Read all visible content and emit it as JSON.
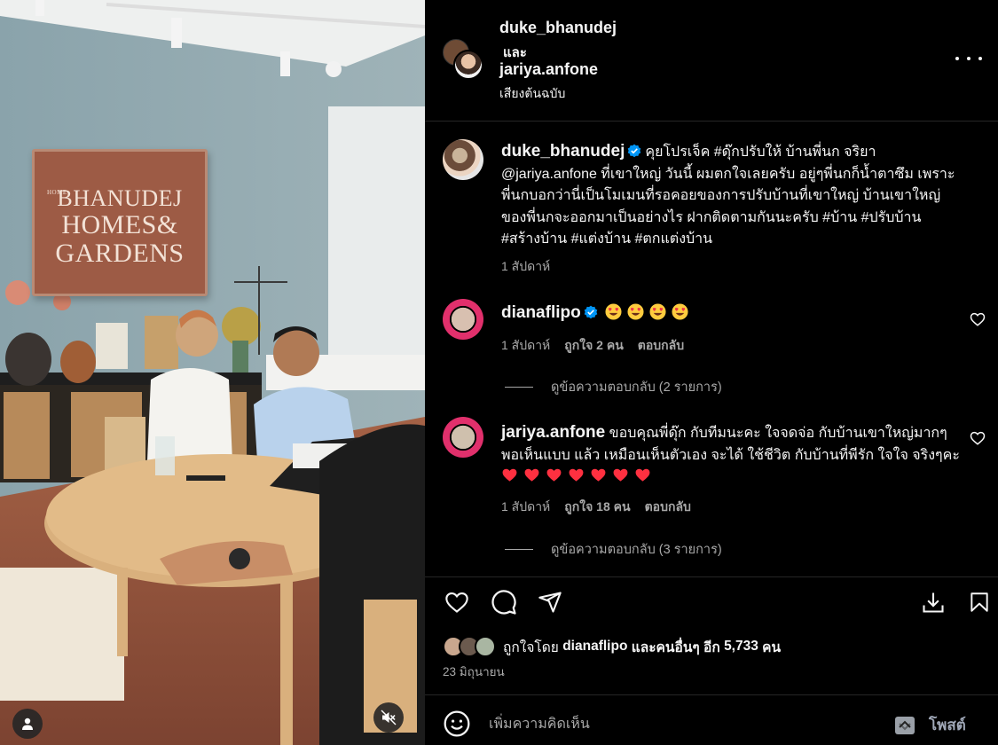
{
  "media": {
    "sign": {
      "small": "HOME",
      "line1": "BHANUDEJ",
      "line2": "HOMES&",
      "line3": "GARDENS"
    },
    "icons": [
      "user-icon",
      "mute-icon"
    ]
  },
  "header": {
    "user1": "duke_bhanudej",
    "and": "และ",
    "user2": "jariya.anfone",
    "audio": "เสียงต้นฉบับ",
    "more_icon": "more-horizontal-icon"
  },
  "caption": {
    "username": "duke_bhanudej",
    "text": "คุยโปรเจ็ค #ดุ๊กปรับให้ บ้านพี่นก จริยา @jariya.anfone ที่เขาใหญ่ วันนี้ ผมตกใจเลยครับ อยู่ๆพี่นกก็น้ำตาซึม เพราะพี่นกบอกว่านี่เป็นโมเมนที่รอคอยของการปรับบ้านที่เขาใหญ่ บ้านเขาใหญ่ของพี่นกจะออกมาเป็นอย่างไร ฝากติดตามกันนะครับ #บ้าน #ปรับบ้าน #สร้างบ้าน #แต่งบ้าน #ตกแต่งบ้าน",
    "time": "1 สัปดาห์"
  },
  "comments": [
    {
      "username": "dianaflipo",
      "emoji_count": 4,
      "time": "1 สัปดาห์",
      "likes": "ถูกใจ 2 คน",
      "reply": "ตอบกลับ",
      "view_replies": "ดูข้อความตอบกลับ (2 รายการ)"
    },
    {
      "username": "jariya.anfone",
      "text": "ขอบคุณพี่ดุ๊ก กับทีมนะคะ ใจจดจ่อ กับบ้านเขาใหญ่มากๆ พอเห็นแบบ แล้ว เหมือนเห็นตัวเอง จะได้ ใช้ชีวิต กับบ้านที่พีรัก ใจใจ จริงๆคะ",
      "heart_count": 7,
      "time": "1 สัปดาห์",
      "likes": "ถูกใจ 18 คน",
      "reply": "ตอบกลับ",
      "view_replies": "ดูข้อความตอบกลับ (3 รายการ)"
    }
  ],
  "actions": [
    "heart-icon",
    "comment-icon",
    "share-icon",
    "download-icon",
    "bookmark-icon"
  ],
  "likes": {
    "prefix": "ถูกใจโดย",
    "user": "dianaflipo",
    "middle": "และคนอื่นๆ อีก",
    "count": "5,733",
    "suffix": "คน"
  },
  "date": "23 มิถุนายน",
  "composer": {
    "placeholder": "เพิ่มความคิดเห็น",
    "post": "โพสต์"
  },
  "colors": {
    "background": "#000000",
    "text": "#f5f5f5",
    "secondary": "#a8a8a8",
    "verified": "#0095f6",
    "heart": "#ff3040",
    "divider": "#262626"
  }
}
